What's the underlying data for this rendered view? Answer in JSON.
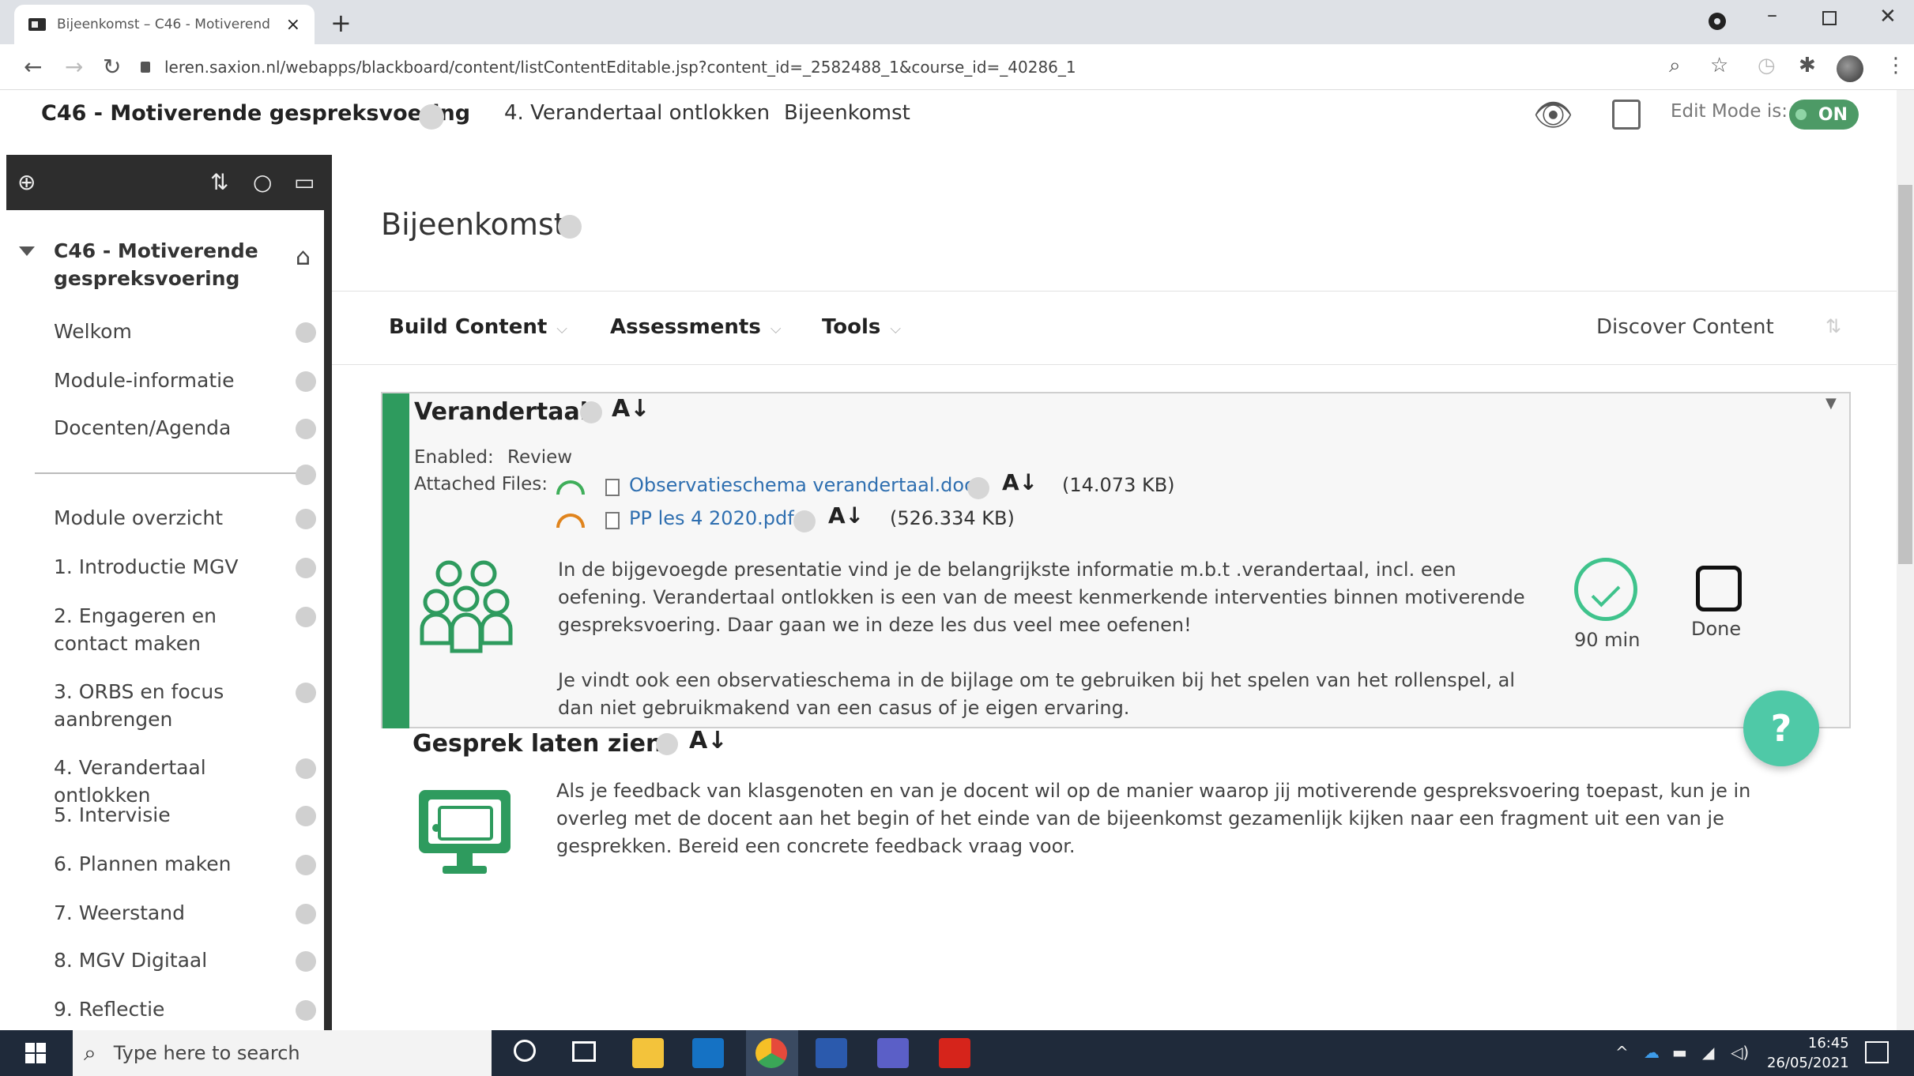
{
  "browser": {
    "tab_title": "Bijeenkomst – C46 - Motiverend",
    "tab_close": "×",
    "new_tab": "+",
    "url": "leren.saxion.nl/webapps/blackboard/content/listContentEditable.jsp?content_id=_2582488_1&course_id=_40286_1"
  },
  "header": {
    "course_title": "C46 - Motiverende gespreksvoering",
    "breadcrumbs": [
      "4. Verandertaal ontlokken",
      "Bijeenkomst"
    ],
    "edit_mode_label": "Edit Mode is:",
    "edit_mode_value": "ON"
  },
  "left_menu": {
    "course_name": "C46 - Motiverende gespreksvoering",
    "items_top": [
      "Welkom",
      "Module-informatie",
      "Docenten/Agenda"
    ],
    "items_bottom": [
      "Module overzicht",
      "1. Introductie MGV",
      "2. Engageren en contact maken",
      "3. ORBS en focus aanbrengen",
      "4. Verandertaal ontlokken",
      "5. Intervisie",
      "6. Plannen maken",
      "7. Weerstand",
      "8. MGV Digitaal",
      "9. Reflectie"
    ]
  },
  "main": {
    "page_title": "Bijeenkomst",
    "actions": [
      "Build Content",
      "Assessments",
      "Tools"
    ],
    "discover": "Discover Content",
    "items": [
      {
        "title": "Verandertaal",
        "enabled_label": "Enabled:",
        "enabled_value": "Review",
        "attached_label": "Attached Files:",
        "files": [
          {
            "name": "Observatieschema verandertaal.docx",
            "size": "(14.073 KB)",
            "gauge_color": "#3fae5a"
          },
          {
            "name": "PP les 4 2020.pdf",
            "size": "(526.334 KB)",
            "gauge_color": "#e0841d"
          }
        ],
        "description_1": "In de bijgevoegde presentatie vind je de belangrijkste informatie m.b.t .verandertaal, incl. een oefening. Verandertaal ontlokken is een van de meest kenmerkende interventies binnen motiverende gespreksvoering. Daar gaan we in deze les dus veel mee oefenen!",
        "description_2": "Je vindt ook een observatieschema in de bijlage om te gebruiken bij het spelen van het rollenspel, al dan niet gebruikmakend van een casus of je eigen ervaring.",
        "duration": "90 min",
        "done_label": "Done"
      },
      {
        "title": "Gesprek laten zien",
        "description": "Als je feedback van klasgenoten en van je docent wil op de manier waarop jij motiverende gespreksvoering toepast, kun je in overleg met de docent aan het begin of het einde van de bijeenkomst gezamenlijk kijken naar een fragment uit een van je gesprekken. Bereid een concrete feedback vraag voor."
      }
    ],
    "help": "?"
  },
  "taskbar": {
    "search_placeholder": "Type here to search",
    "time": "16:45",
    "date": "26/05/2021"
  },
  "colors": {
    "accent_green": "#2e9b5e",
    "link_blue": "#2f6fb0",
    "help_teal": "#4fc9a7"
  }
}
